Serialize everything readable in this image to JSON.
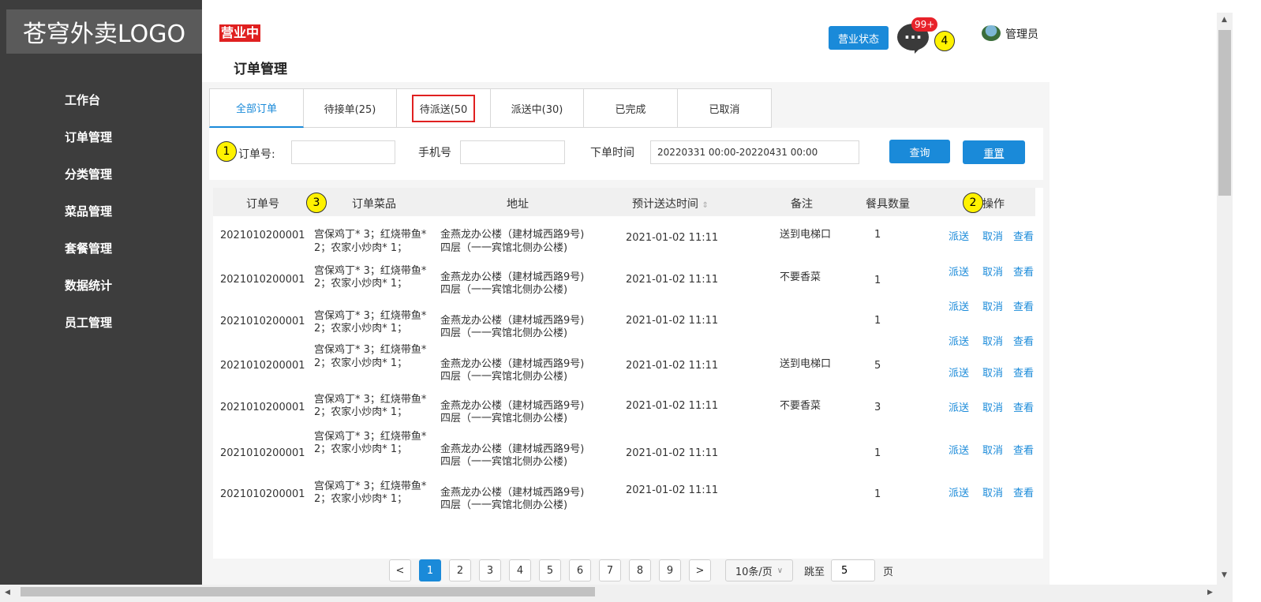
{
  "logo": "苍穹外卖LOGO",
  "sidebar": {
    "items": [
      "工作台",
      "订单管理",
      "分类管理",
      "菜品管理",
      "套餐管理",
      "数据统计",
      "员工管理"
    ]
  },
  "header": {
    "status_tag": "营业中",
    "page_title": "订单管理",
    "status_button": "营业状态",
    "message_badge": "99+",
    "message_icon": "···",
    "admin_name": "管理员"
  },
  "markers": [
    "1",
    "2",
    "3",
    "4"
  ],
  "tabs": [
    "全部订单",
    "待接单(25)",
    "待派送(50",
    "派送中(30)",
    "已完成",
    "已取消"
  ],
  "filters": {
    "order_no_label": "订单号:",
    "phone_label": "手机号",
    "time_label": "下单时间",
    "time_value": "20220331 00:00-20220431 00:00",
    "query_button": "查询",
    "reset_button": "重置"
  },
  "table": {
    "columns": [
      "订单号",
      "订单菜品",
      "地址",
      "预计送达时间",
      "备注",
      "餐具数量",
      "操作"
    ],
    "rows": [
      {
        "order_no": "2021010200001",
        "dish1": "宫保鸡丁* 3；红烧带鱼*",
        "dish2": "2；农家小炒肉* 1；",
        "addr1": "金燕龙办公楼（建材城西路9号)",
        "addr2": "四层（一一宾馆北侧办公楼)",
        "time": "2021-01-02 11:11",
        "note": "送到电梯口",
        "qty": "1"
      },
      {
        "order_no": "2021010200001",
        "dish1": "宫保鸡丁* 3；红烧带鱼*",
        "dish2": "2；农家小炒肉* 1；",
        "addr1": "金燕龙办公楼（建材城西路9号)",
        "addr2": "四层（一一宾馆北侧办公楼)",
        "time": "2021-01-02 11:11",
        "note": "不要香菜",
        "qty": "1"
      },
      {
        "order_no": "2021010200001",
        "dish1": "宫保鸡丁* 3；红烧带鱼*",
        "dish2": "2；农家小炒肉* 1；",
        "addr1": "金燕龙办公楼（建材城西路9号)",
        "addr2": "四层（一一宾馆北侧办公楼)",
        "time": "2021-01-02 11:11",
        "note": "",
        "qty": "1"
      },
      {
        "order_no": "2021010200001",
        "dish1": "宫保鸡丁* 3；红烧带鱼*",
        "dish2": "2；农家小炒肉* 1；",
        "addr1": "金燕龙办公楼（建材城西路9号)",
        "addr2": "四层（一一宾馆北侧办公楼)",
        "time": "2021-01-02 11:11",
        "note": "送到电梯口",
        "qty": "5"
      },
      {
        "order_no": "2021010200001",
        "dish1": "宫保鸡丁* 3；红烧带鱼*",
        "dish2": "2；农家小炒肉* 1；",
        "addr1": "金燕龙办公楼（建材城西路9号)",
        "addr2": "四层（一一宾馆北侧办公楼)",
        "time": "2021-01-02 11:11",
        "note": "不要香菜",
        "qty": "3"
      },
      {
        "order_no": "2021010200001",
        "dish1": "宫保鸡丁* 3；红烧带鱼*",
        "dish2": "2；农家小炒肉* 1；",
        "addr1": "金燕龙办公楼（建材城西路9号)",
        "addr2": "四层（一一宾馆北侧办公楼)",
        "time": "2021-01-02 11:11",
        "note": "",
        "qty": "1"
      },
      {
        "order_no": "2021010200001",
        "dish1": "宫保鸡丁* 3；红烧带鱼*",
        "dish2": "2；农家小炒肉* 1；",
        "addr1": "金燕龙办公楼（建材城西路9号)",
        "addr2": "四层（一一宾馆北侧办公楼)",
        "time": "2021-01-02 11:11",
        "note": "",
        "qty": "1"
      }
    ],
    "actions": [
      "派送",
      "取消",
      "查看"
    ]
  },
  "pagination": {
    "prev": "<",
    "pages": [
      "1",
      "2",
      "3",
      "4",
      "5",
      "6",
      "7",
      "8",
      "9"
    ],
    "next": ">",
    "page_size": "10条/页",
    "jump_label": "跳至",
    "jump_value": "5",
    "page_suffix": "页"
  }
}
